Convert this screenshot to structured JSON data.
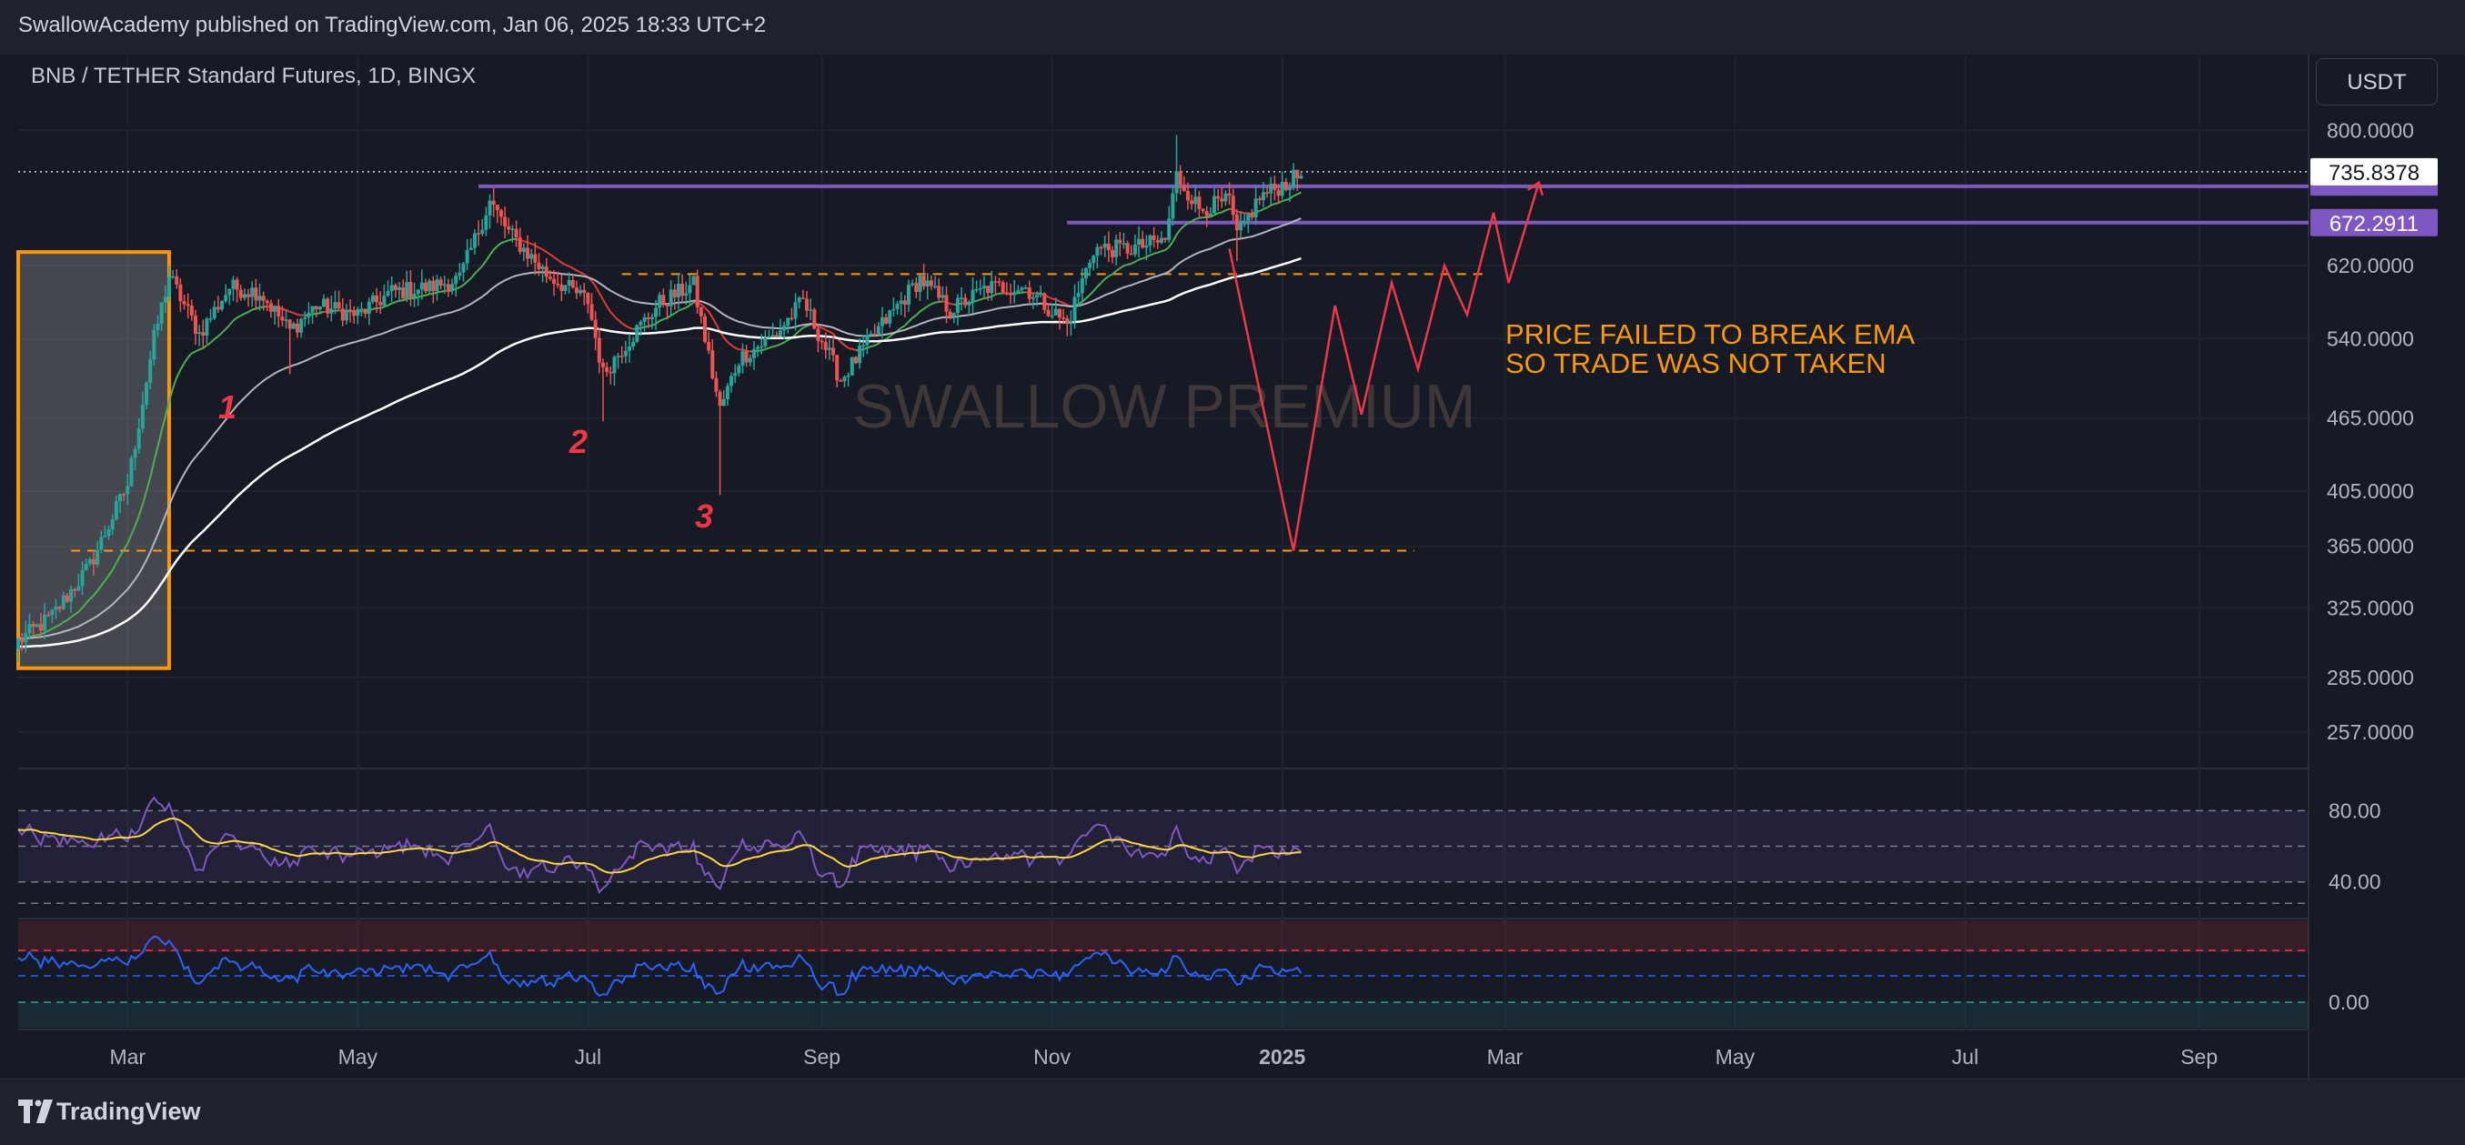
{
  "header": {
    "published_line": "SwallowAcademy published on TradingView.com, Jan 06, 2025 18:33 UTC+2"
  },
  "chart": {
    "symbol_title": "BNB / TETHER Standard Futures, 1D, BINGX",
    "currency": "USDT",
    "watermark": "SWALLOW PREMIUM",
    "annotation": [
      "PRICE FAILED TO BREAK EMA",
      "SO TRADE WAS NOT TAKEN"
    ],
    "wave_labels": [
      "1",
      "2",
      "3"
    ]
  },
  "footer": {
    "brand": "TradingView"
  },
  "colors": {
    "background": "#131722",
    "panel": "#161a25",
    "up_candle": "#26a69a",
    "down_candle": "#ef5350",
    "purple_line": "#7e57c2",
    "orange": "#ff9800",
    "projection_red": "#f23645",
    "ema_green": "#4caf50",
    "ema_red": "#e53935",
    "ma_grey": "#b2b5be",
    "ma_white": "#ffffff",
    "rsi_line": "#7e57c2",
    "rsi_signal": "#fdd835",
    "momentum_line": "#2962ff"
  },
  "chart_data": {
    "type": "line",
    "subtype": "candlestick",
    "y_axis_scale": "log",
    "price_axis_ticks": [
      "800.0000",
      "620.0000",
      "540.0000",
      "465.0000",
      "405.0000",
      "365.0000",
      "325.0000",
      "285.0000",
      "257.0000"
    ],
    "price_labels": [
      "735.8378",
      "672.2911"
    ],
    "x_axis_ticks": [
      "Mar",
      "May",
      "Jul",
      "Sep",
      "Nov",
      "2025",
      "Mar",
      "May",
      "Jul",
      "Sep"
    ],
    "ylim": [
      240,
      840
    ],
    "xlim": [
      "2024-02-01",
      "2025-09-30"
    ],
    "close_anchors": [
      {
        "date": "2024-02-01",
        "close": 305
      },
      {
        "date": "2024-02-10",
        "close": 320
      },
      {
        "date": "2024-02-20",
        "close": 352
      },
      {
        "date": "2024-03-01",
        "close": 410
      },
      {
        "date": "2024-03-08",
        "close": 540
      },
      {
        "date": "2024-03-12",
        "close": 608
      },
      {
        "date": "2024-03-20",
        "close": 545
      },
      {
        "date": "2024-03-28",
        "close": 595
      },
      {
        "date": "2024-04-05",
        "close": 590
      },
      {
        "date": "2024-04-13",
        "close": 548
      },
      {
        "date": "2024-04-20",
        "close": 575
      },
      {
        "date": "2024-05-01",
        "close": 565
      },
      {
        "date": "2024-05-10",
        "close": 590
      },
      {
        "date": "2024-05-20",
        "close": 595
      },
      {
        "date": "2024-05-28",
        "close": 605
      },
      {
        "date": "2024-06-05",
        "close": 700
      },
      {
        "date": "2024-06-10",
        "close": 660
      },
      {
        "date": "2024-06-20",
        "close": 610
      },
      {
        "date": "2024-07-01",
        "close": 580
      },
      {
        "date": "2024-07-05",
        "close": 505
      },
      {
        "date": "2024-07-10",
        "close": 530
      },
      {
        "date": "2024-07-20",
        "close": 578
      },
      {
        "date": "2024-07-29",
        "close": 598
      },
      {
        "date": "2024-08-05",
        "close": 472
      },
      {
        "date": "2024-08-10",
        "close": 520
      },
      {
        "date": "2024-08-20",
        "close": 545
      },
      {
        "date": "2024-08-27",
        "close": 580
      },
      {
        "date": "2024-09-06",
        "close": 500
      },
      {
        "date": "2024-09-15",
        "close": 545
      },
      {
        "date": "2024-09-27",
        "close": 605
      },
      {
        "date": "2024-10-05",
        "close": 570
      },
      {
        "date": "2024-10-15",
        "close": 595
      },
      {
        "date": "2024-10-25",
        "close": 595
      },
      {
        "date": "2024-11-05",
        "close": 555
      },
      {
        "date": "2024-11-12",
        "close": 640
      },
      {
        "date": "2024-11-22",
        "close": 640
      },
      {
        "date": "2024-12-01",
        "close": 650
      },
      {
        "date": "2024-12-04",
        "close": 735
      },
      {
        "date": "2024-12-10",
        "close": 690
      },
      {
        "date": "2024-12-18",
        "close": 700
      },
      {
        "date": "2024-12-20",
        "close": 655
      },
      {
        "date": "2024-12-26",
        "close": 705
      },
      {
        "date": "2025-01-06",
        "close": 736
      }
    ],
    "horizontal_levels": [
      {
        "name": "resistance-upper",
        "price": 720,
        "from": "2024-06-02",
        "to": "2025-09-30",
        "style": "solid purple"
      },
      {
        "name": "resistance-lower",
        "price": 672.29,
        "from": "2024-11-05",
        "to": "2025-09-30",
        "style": "solid purple"
      },
      {
        "name": "support-upper",
        "price": 610,
        "from": "2024-07-10",
        "to": "2025-02-25",
        "style": "dashed orange"
      },
      {
        "name": "support-lower",
        "price": 362,
        "from": "2024-02-15",
        "to": "2025-02-05",
        "style": "dashed orange"
      }
    ],
    "highlight_box": {
      "from": "2024-02-01",
      "to": "2024-03-12",
      "price_low": 290,
      "price_high": 636
    },
    "projection_path": [
      {
        "date": "2024-12-18",
        "price": 640
      },
      {
        "date": "2025-01-04",
        "price": 362
      },
      {
        "date": "2025-01-15",
        "price": 575
      },
      {
        "date": "2025-01-22",
        "price": 468
      },
      {
        "date": "2025-01-30",
        "price": 600
      },
      {
        "date": "2025-02-06",
        "price": 510
      },
      {
        "date": "2025-02-13",
        "price": 620
      },
      {
        "date": "2025-02-19",
        "price": 565
      },
      {
        "date": "2025-02-26",
        "price": 685
      },
      {
        "date": "2025-03-02",
        "price": 600
      },
      {
        "date": "2025-03-10",
        "price": 725
      }
    ],
    "indicators": {
      "rsi": {
        "ticks": [
          "80.00",
          "40.00"
        ],
        "band": [
          40,
          80
        ],
        "level_lines": [
          80,
          60,
          40
        ]
      },
      "momentum": {
        "ticks": [
          "0.00"
        ]
      }
    },
    "grid": true
  }
}
